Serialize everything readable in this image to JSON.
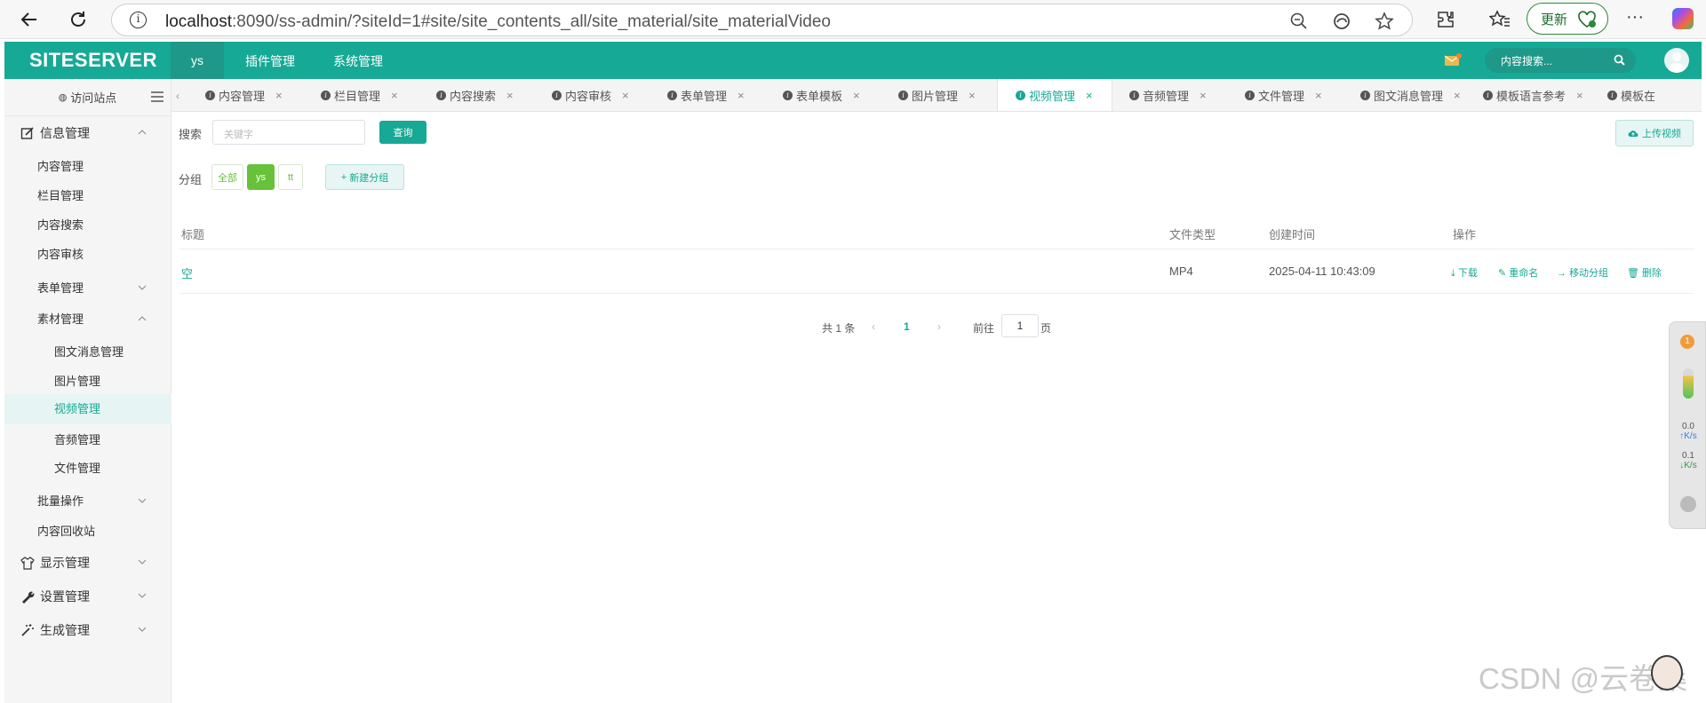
{
  "browser": {
    "url_host": "localhost",
    "url_rest": ":8090/ss-admin/?siteId=1#site/site_contents_all/site_material/site_materialVideo",
    "update_label": "更新"
  },
  "header": {
    "logo": "SITESERVER",
    "site_tab": "ys",
    "menu": [
      "插件管理",
      "系统管理"
    ],
    "search_placeholder": "内容搜索..."
  },
  "sidebar": {
    "visit": "访问站点",
    "items": [
      {
        "label": "信息管理",
        "level": 1,
        "icon": "edit-icon",
        "chevron": "up"
      },
      {
        "label": "内容管理",
        "level": 2
      },
      {
        "label": "栏目管理",
        "level": 2
      },
      {
        "label": "内容搜索",
        "level": 2
      },
      {
        "label": "内容审核",
        "level": 2
      },
      {
        "label": "表单管理",
        "level": 2,
        "chevron": "down"
      },
      {
        "label": "素材管理",
        "level": 2,
        "chevron": "up"
      },
      {
        "label": "图文消息管理",
        "level": 3
      },
      {
        "label": "图片管理",
        "level": 3
      },
      {
        "label": "视频管理",
        "level": 3,
        "active": true
      },
      {
        "label": "音频管理",
        "level": 3
      },
      {
        "label": "文件管理",
        "level": 3
      },
      {
        "label": "批量操作",
        "level": 2,
        "chevron": "down"
      },
      {
        "label": "内容回收站",
        "level": 2
      },
      {
        "label": "显示管理",
        "level": 1,
        "icon": "shirt-icon",
        "chevron": "down"
      },
      {
        "label": "设置管理",
        "level": 1,
        "icon": "wrench-icon",
        "chevron": "down"
      },
      {
        "label": "生成管理",
        "level": 1,
        "icon": "magic-icon",
        "chevron": "down"
      }
    ]
  },
  "tabs": [
    {
      "label": "内容管理"
    },
    {
      "label": "栏目管理"
    },
    {
      "label": "内容搜索"
    },
    {
      "label": "内容审核"
    },
    {
      "label": "表单管理"
    },
    {
      "label": "表单模板"
    },
    {
      "label": "图片管理"
    },
    {
      "label": "视频管理",
      "active": true
    },
    {
      "label": "音频管理"
    },
    {
      "label": "文件管理"
    },
    {
      "label": "图文消息管理"
    },
    {
      "label": "模板语言参考"
    },
    {
      "label": "模板在"
    }
  ],
  "toolbar": {
    "search_label": "搜索",
    "search_placeholder": "关键字",
    "query_button": "查询",
    "upload_button": "上传视频",
    "group_label": "分组",
    "groups": [
      {
        "label": "全部",
        "selected": false
      },
      {
        "label": "ys",
        "selected": true
      },
      {
        "label": "tt",
        "selected": false
      }
    ],
    "new_group_button": "新建分组"
  },
  "table": {
    "headers": [
      "标题",
      "文件类型",
      "创建时间",
      "操作"
    ],
    "rows": [
      {
        "title": "空",
        "file_type": "MP4",
        "created": "2025-04-11 10:43:09"
      }
    ],
    "actions": [
      "下载",
      "重命名",
      "移动分组",
      "删除"
    ]
  },
  "pager": {
    "total_text": "共 1 条",
    "current_page": "1",
    "goto_label": "前往",
    "goto_value": "1",
    "page_suffix": "页"
  },
  "float_widget": {
    "badge": "1",
    "up_speed": "0.0",
    "up_unit": "K/s",
    "down_speed": "0.1",
    "down_unit": "K/s"
  },
  "watermark": "CSDN @云卷桑",
  "colors": {
    "brand": "#16a995",
    "group_green": "#67c23a"
  }
}
